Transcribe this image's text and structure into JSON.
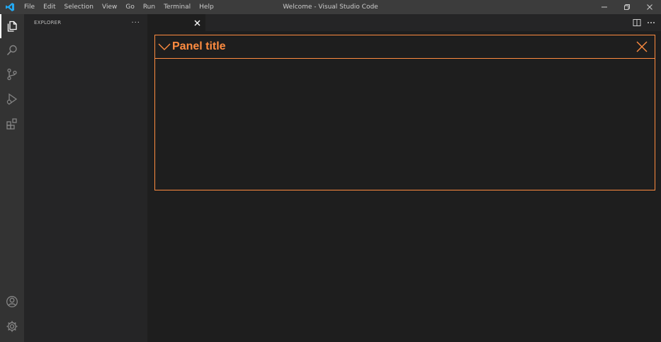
{
  "titlebar": {
    "menu": [
      "File",
      "Edit",
      "Selection",
      "View",
      "Go",
      "Run",
      "Terminal",
      "Help"
    ],
    "window_title": "Welcome - Visual Studio Code"
  },
  "activitybar": {
    "icons": [
      "files-icon",
      "search-icon",
      "source-control-icon",
      "run-debug-icon",
      "extensions-icon",
      "account-icon",
      "settings-gear-icon"
    ]
  },
  "sidebar": {
    "title": "EXPLORER",
    "more": "···"
  },
  "panel": {
    "title": "Panel title",
    "accent": "#ff8c40"
  },
  "colors": {
    "titlebar": "#3c3c3c",
    "activitybar": "#333333",
    "sidebar": "#252526",
    "editor": "#1e1e1e"
  }
}
